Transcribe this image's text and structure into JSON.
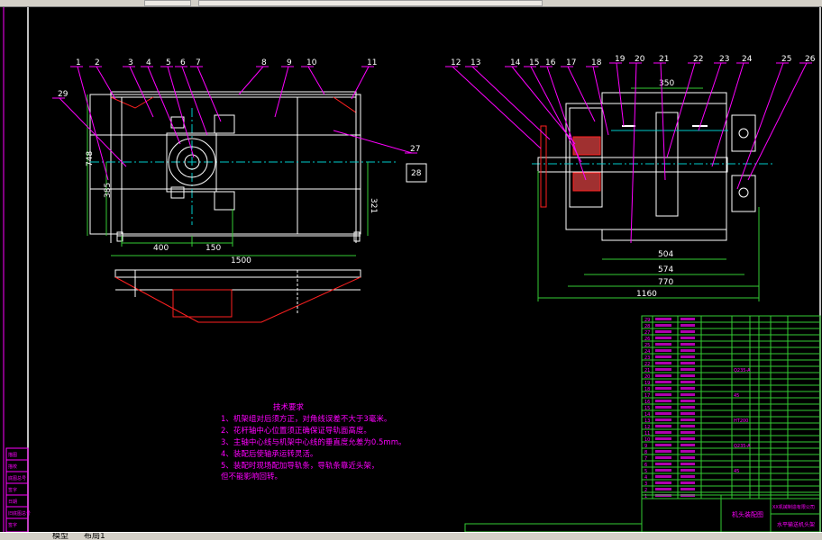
{
  "colors": {
    "background": "#000000",
    "outline": "#ffffff",
    "dimension": "#33cc33",
    "leader": "#ff00ff",
    "hatch": "#ff2020",
    "center": "#00cccc"
  },
  "tabs": {
    "model": "模型",
    "layout1": "布局1"
  },
  "left_view": {
    "balloons": [
      "1",
      "2",
      "3",
      "4",
      "5",
      "6",
      "7",
      "8",
      "9",
      "10",
      "11",
      "29",
      "27",
      "28"
    ],
    "dims": {
      "height_total": "748",
      "height_center": "385",
      "height_right": "321",
      "width_a": "400",
      "width_b": "150",
      "width_total": "1500"
    }
  },
  "right_view": {
    "balloons": [
      "12",
      "13",
      "14",
      "15",
      "16",
      "17",
      "18",
      "19",
      "20",
      "21",
      "22",
      "23",
      "24",
      "25",
      "26"
    ],
    "dims": {
      "top": "350",
      "d1": "504",
      "d2": "574",
      "d3": "770",
      "d4": "1160"
    }
  },
  "notes": {
    "title": "技术要求",
    "lines": [
      "1、机架组对后须方正，对角线误差不大于3毫米。",
      "2、花杆轴中心位置须正确保证导轨面高度。",
      "3、主轴中心线与机架中心线的垂直度允差为0.5mm。",
      "4、装配后使轴承运转灵活。",
      "5、装配时现场配加导轨条，导轨条靠近头架，",
      "   但不能影响回转。"
    ]
  },
  "title_block": {
    "drawing_name": "水平输送机头架",
    "company": "XX机械制造有限公司",
    "project": "机头装配图",
    "material_col": [
      "Q235-A",
      "45",
      "HT200",
      "Q235-A",
      "45"
    ]
  },
  "parts_table": {
    "row_numbers": [
      "29",
      "28",
      "27",
      "26",
      "25",
      "24",
      "23",
      "22",
      "21",
      "20",
      "19",
      "18",
      "17",
      "16",
      "15",
      "14",
      "13",
      "12",
      "11",
      "10",
      "9",
      "8",
      "7",
      "6",
      "5",
      "4",
      "3",
      "2",
      "1"
    ]
  },
  "side_table": {
    "rows": [
      "描图",
      "描校",
      "底图总号",
      "签字",
      "日期",
      "旧底图总号",
      "签字"
    ]
  }
}
